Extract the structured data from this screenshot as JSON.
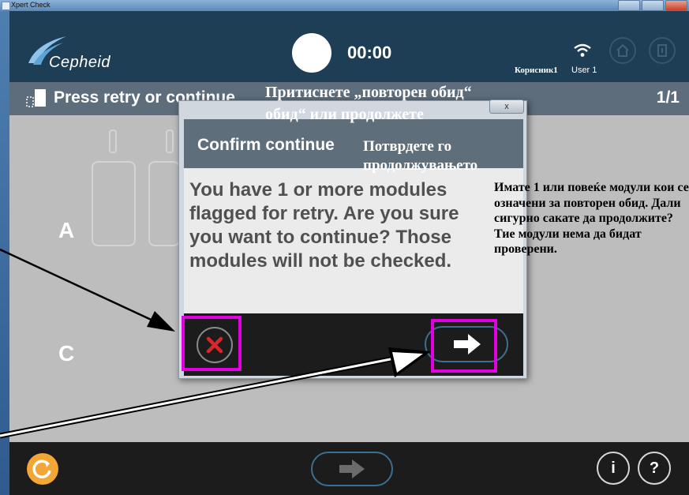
{
  "window": {
    "title": "Xpert Check"
  },
  "header": {
    "logo": "Cepheid",
    "timer": "00:00",
    "user_name_mk": "Корисник1",
    "user_name": "User 1"
  },
  "instruction": {
    "text": "Press retry or continue",
    "page": "1/1",
    "text_mk_line1": "Притиснете „повторен обид“",
    "text_mk_line2": "обид“ или продолжете"
  },
  "modules": {
    "rows": [
      "A",
      "C"
    ]
  },
  "dialog": {
    "close_label": "x",
    "title": "Confirm continue",
    "title_mk_line1": "Потврдете го",
    "title_mk_line2": "продолжувањето",
    "message": "You have 1 or more modules flagged for retry.  Are you sure you want to continue?  Those modules will not be checked.",
    "message_mk": "Имате 1 или повеќе модули кои се означени за повторен обид. Дали сигурно сакате да продолжите? Тие модули нема да бидат проверени."
  },
  "bottom_bar": {
    "info_label": "i",
    "help_label": "?"
  },
  "colors": {
    "header": "#1e3e55",
    "instruction_bar": "#5e6d7b",
    "highlight": "#e000e0",
    "cancel_x": "#d9262c",
    "reset": "#f2a636"
  },
  "icons": [
    "cepheid-logo-icon",
    "wifi-icon",
    "home-icon",
    "exit-icon",
    "instruction-icon",
    "cancel-x-icon",
    "arrow-right-icon",
    "reset-icon",
    "info-icon",
    "help-icon"
  ]
}
